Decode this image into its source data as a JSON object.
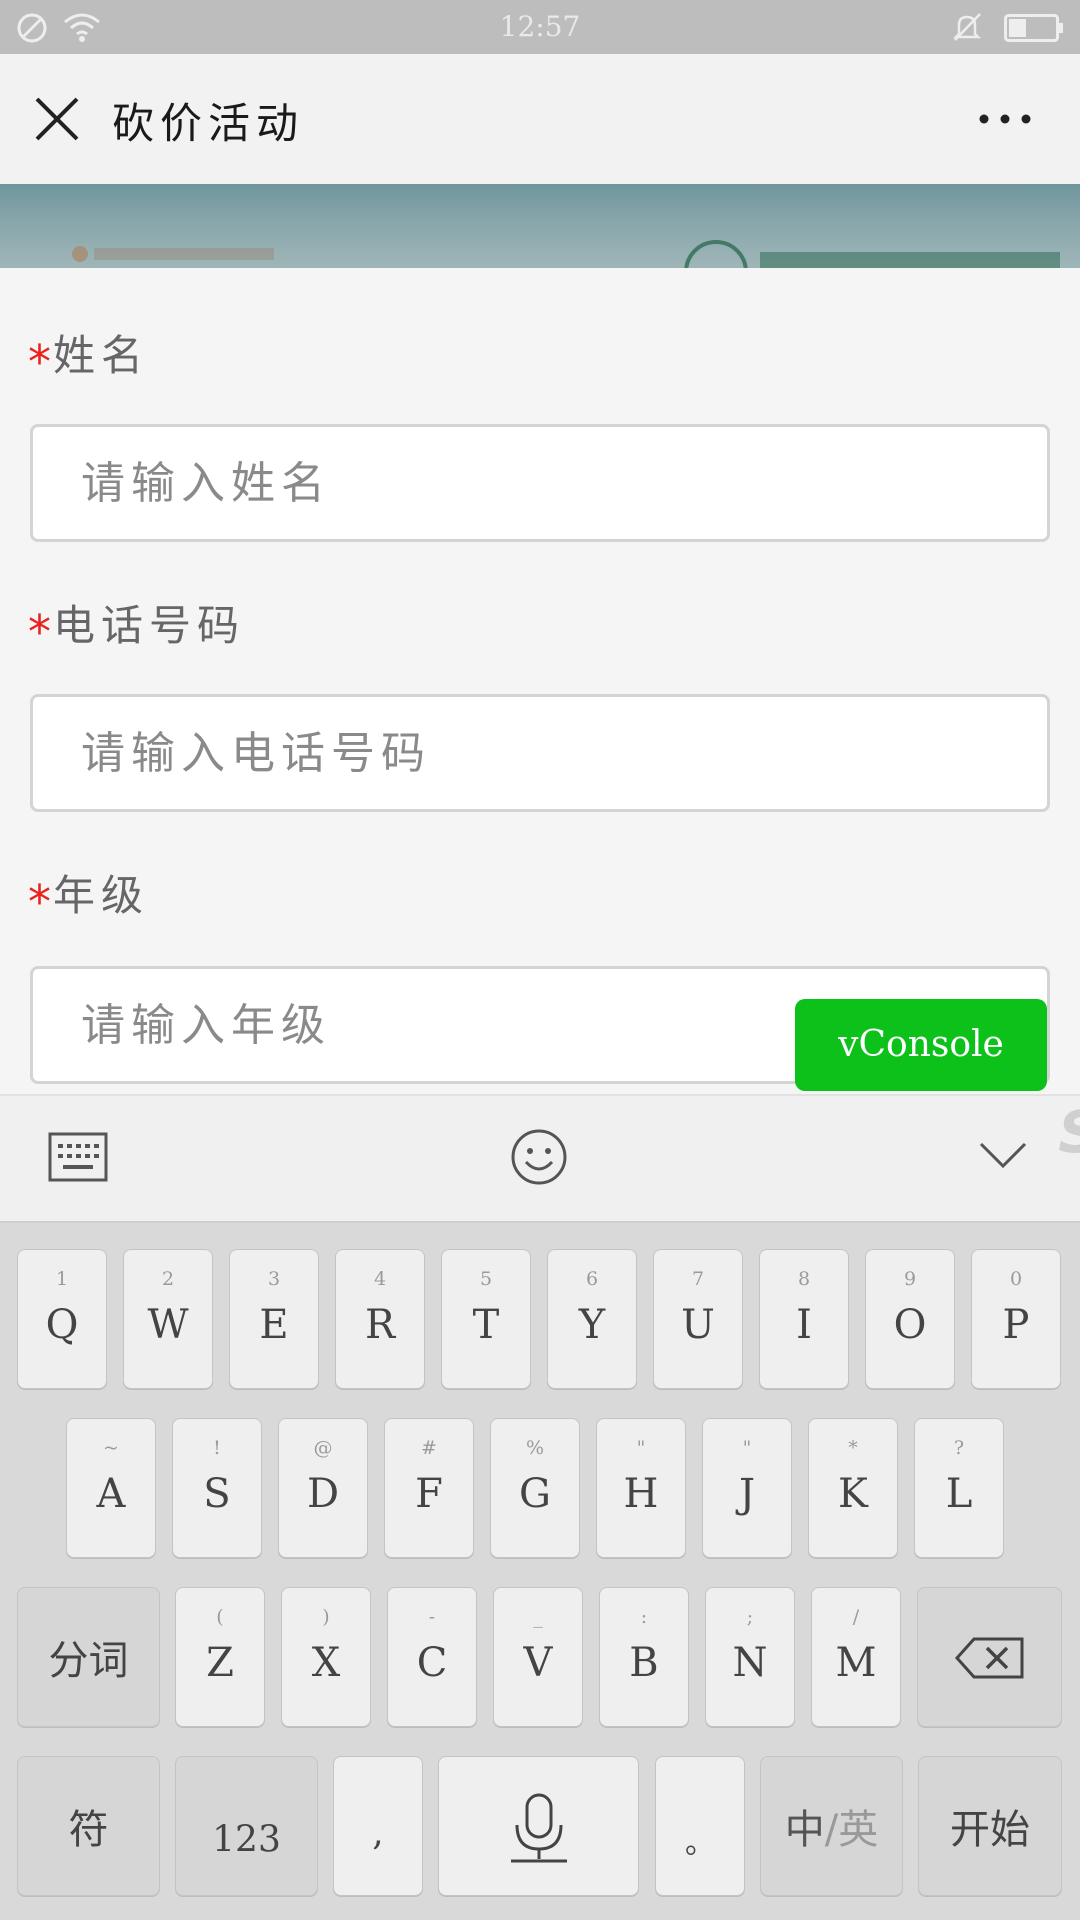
{
  "status_bar": {
    "time": "12:57",
    "icons": [
      "no-disturb-icon",
      "wifi-icon",
      "bell-muted-icon",
      "battery-icon"
    ]
  },
  "nav": {
    "title": "砍价活动",
    "close_icon": "close-icon",
    "more_icon": "more-icon"
  },
  "form": {
    "required_mark": "*",
    "fields": [
      {
        "label": "姓名",
        "placeholder": "请输入姓名",
        "value": ""
      },
      {
        "label": "电话号码",
        "placeholder": "请输入电话号码",
        "value": ""
      },
      {
        "label": "年级",
        "placeholder": "请输入年级",
        "value": ""
      }
    ]
  },
  "vconsole": {
    "label": "vConsole"
  },
  "keyboard_toolbar": {
    "icons": [
      "keyboard-icon",
      "emoji-icon",
      "collapse-icon"
    ],
    "brand_mark": "S"
  },
  "keyboard": {
    "row1": [
      {
        "hint": "1",
        "key": "Q"
      },
      {
        "hint": "2",
        "key": "W"
      },
      {
        "hint": "3",
        "key": "E"
      },
      {
        "hint": "4",
        "key": "R"
      },
      {
        "hint": "5",
        "key": "T"
      },
      {
        "hint": "6",
        "key": "Y"
      },
      {
        "hint": "7",
        "key": "U"
      },
      {
        "hint": "8",
        "key": "I"
      },
      {
        "hint": "9",
        "key": "O"
      },
      {
        "hint": "0",
        "key": "P"
      }
    ],
    "row2": [
      {
        "hint": "~",
        "key": "A"
      },
      {
        "hint": "!",
        "key": "S"
      },
      {
        "hint": "@",
        "key": "D"
      },
      {
        "hint": "#",
        "key": "F"
      },
      {
        "hint": "%",
        "key": "G"
      },
      {
        "hint": "\"",
        "key": "H"
      },
      {
        "hint": "\"",
        "key": "J"
      },
      {
        "hint": "*",
        "key": "K"
      },
      {
        "hint": "?",
        "key": "L"
      }
    ],
    "row3": [
      {
        "hint": "(",
        "key": "Z"
      },
      {
        "hint": ")",
        "key": "X"
      },
      {
        "hint": "-",
        "key": "C"
      },
      {
        "hint": "_",
        "key": "V"
      },
      {
        "hint": ":",
        "key": "B"
      },
      {
        "hint": ";",
        "key": "N"
      },
      {
        "hint": "/",
        "key": "M"
      }
    ],
    "segment_label": "分词",
    "symbol_label": "符",
    "number_label": "123",
    "comma_label": ",",
    "period_label": "。",
    "lang_zh": "中",
    "lang_sep": "/",
    "lang_en": "英",
    "enter_label": "开始",
    "icons": [
      "backspace-icon",
      "microphone-icon"
    ]
  },
  "colors": {
    "required": "#e8231d",
    "vconsole": "#0cc11a",
    "status_bar": "#bdbdbd"
  }
}
